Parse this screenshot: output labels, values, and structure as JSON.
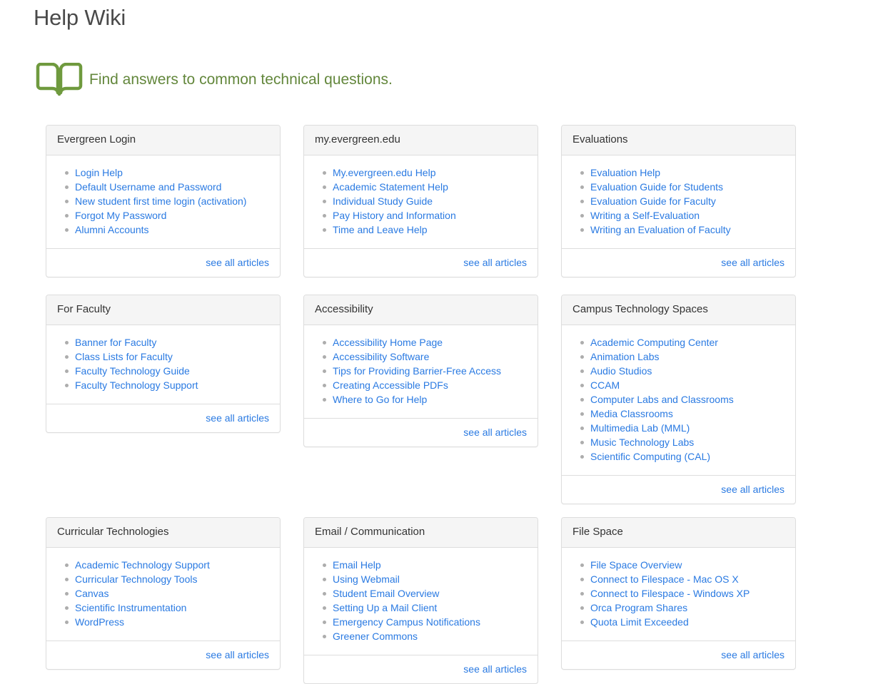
{
  "header": {
    "title": "Help Wiki",
    "tagline": "Find answers to common technical questions.",
    "book_icon": "open-book-icon",
    "title_color": "#4a4a4a",
    "tagline_color": "#63873c",
    "link_color": "#2a7ae2"
  },
  "see_all_label": "see all articles",
  "cards": [
    {
      "title": "Evergreen Login",
      "links": [
        "Login Help",
        "Default Username and Password",
        "New student first time login (activation)",
        "Forgot My Password",
        "Alumni Accounts"
      ],
      "footer": "see all articles"
    },
    {
      "title": "my.evergreen.edu",
      "links": [
        "My.evergreen.edu Help",
        "Academic Statement Help",
        "Individual Study Guide",
        "Pay History and Information",
        "Time and Leave Help"
      ],
      "footer": "see all articles"
    },
    {
      "title": "Evaluations",
      "links": [
        "Evaluation Help",
        "Evaluation Guide for Students",
        "Evaluation Guide for Faculty",
        "Writing a Self-Evaluation",
        "Writing an Evaluation of Faculty"
      ],
      "footer": "see all articles"
    },
    {
      "title": "For Faculty",
      "links": [
        "Banner for Faculty",
        "Class Lists for Faculty",
        "Faculty Technology Guide",
        "Faculty Technology Support"
      ],
      "footer": "see all articles"
    },
    {
      "title": "Accessibility",
      "links": [
        "Accessibility Home Page",
        "Accessibility Software",
        "Tips for Providing Barrier-Free Access",
        "Creating Accessible PDFs",
        "Where to Go for Help"
      ],
      "footer": "see all articles"
    },
    {
      "title": "Campus Technology Spaces",
      "links": [
        "Academic Computing Center",
        "Animation Labs",
        "Audio Studios",
        "CCAM",
        "Computer Labs and Classrooms",
        "Media Classrooms",
        "Multimedia Lab (MML)",
        "Music Technology Labs",
        "Scientific Computing (CAL)"
      ],
      "footer": "see all articles"
    },
    {
      "title": "Curricular Technologies",
      "links": [
        "Academic Technology Support",
        "Curricular Technology Tools",
        "Canvas",
        "Scientific Instrumentation",
        "WordPress"
      ],
      "footer": "see all articles"
    },
    {
      "title": "Email / Communication",
      "links": [
        "Email Help",
        "Using Webmail",
        "Student Email Overview",
        "Setting Up a Mail Client",
        "Emergency Campus Notifications",
        "Greener Commons"
      ],
      "footer": "see all articles"
    },
    {
      "title": "File Space",
      "links": [
        "File Space Overview",
        "Connect to Filespace - Mac OS X",
        "Connect to Filespace - Windows XP",
        "Orca Program Shares",
        "Quota Limit Exceeded"
      ],
      "footer": "see all articles"
    }
  ]
}
